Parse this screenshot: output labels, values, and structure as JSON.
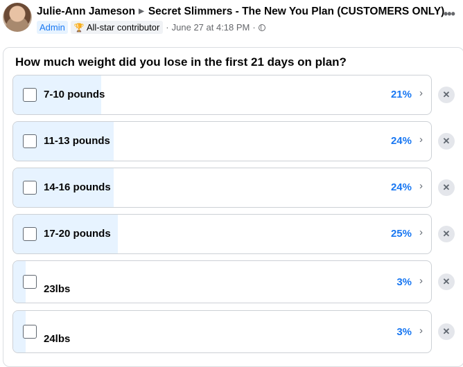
{
  "post": {
    "author": "Julie-Ann Jameson",
    "group": "Secret Slimmers - The New You Plan (CUSTOMERS ONLY)",
    "admin_badge": "Admin",
    "allstar_badge": "All-star contributor",
    "timestamp": "June 27 at 4:18 PM",
    "separator": "·",
    "privacy_icon": "globe-icon",
    "more_icon": "more-options-icon"
  },
  "poll": {
    "question": "How much weight did you lose in the first 21 days on plan?",
    "options": [
      {
        "label": "7-10 pounds",
        "percent": "21%",
        "value": 21
      },
      {
        "label": "11-13 pounds",
        "percent": "24%",
        "value": 24
      },
      {
        "label": "14-16 pounds",
        "percent": "24%",
        "value": 24
      },
      {
        "label": "17-20 pounds",
        "percent": "25%",
        "value": 25
      },
      {
        "label": "23lbs",
        "percent": "3%",
        "value": 3
      },
      {
        "label": "24lbs",
        "percent": "3%",
        "value": 3
      }
    ]
  },
  "colors": {
    "accent": "#1877f2",
    "fill": "#e7f3ff",
    "border": "#ccd0d5"
  }
}
